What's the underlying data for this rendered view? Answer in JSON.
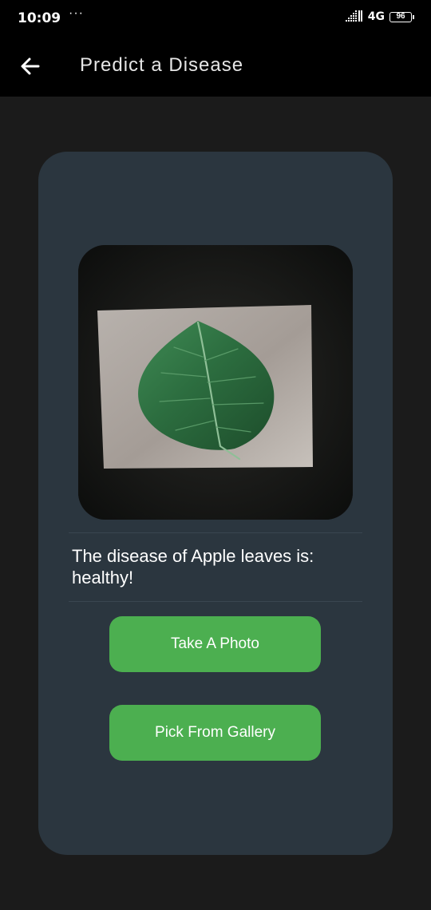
{
  "status_bar": {
    "time": "10:09",
    "dots": "···",
    "network": "4G",
    "battery": "96"
  },
  "app_bar": {
    "title": "Predict a Disease"
  },
  "result": {
    "text": "The disease of Apple leaves is: healthy!"
  },
  "buttons": {
    "take_photo": "Take A Photo",
    "pick_gallery": "Pick From Gallery"
  },
  "colors": {
    "background": "#1b1b1b",
    "app_bar": "#000000",
    "card": "#2b363f",
    "button": "#4caf50",
    "text": "#ffffff"
  },
  "icons": {
    "back": "arrow-left-icon",
    "signal": "signal-bars-icon",
    "battery": "battery-icon"
  }
}
